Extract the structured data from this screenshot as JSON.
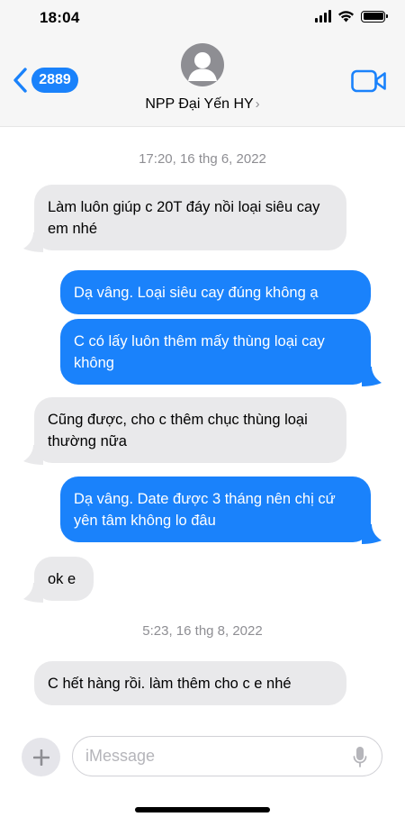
{
  "status_bar": {
    "time": "18:04",
    "icons": [
      "signal-icon",
      "wifi-icon",
      "battery-icon"
    ]
  },
  "header": {
    "back_badge": "2889",
    "contact_name": "NPP Đại Yến HY",
    "contact_chevron": "›",
    "icons": [
      "back-chevron-icon",
      "avatar-icon",
      "video-call-icon"
    ]
  },
  "colors": {
    "accent": "#1a82fb",
    "incoming_bubble": "#e9e9eb",
    "timestamp": "#8e8e93"
  },
  "conversation": {
    "timestamps": [
      "17:20, 16 thg 6, 2022",
      "5:23, 16 thg 8, 2022"
    ],
    "messages": [
      {
        "direction": "in",
        "text": "Làm luôn giúp c 20T đáy nồi loại siêu cay em nhé"
      },
      {
        "direction": "out",
        "text": "Dạ vâng. Loại siêu cay đúng không ạ"
      },
      {
        "direction": "out",
        "text": "C có lấy luôn thêm mấy thùng loại cay không"
      },
      {
        "direction": "in",
        "text": "Cũng được, cho c thêm chục thùng loại thường nữa"
      },
      {
        "direction": "out",
        "text": "Dạ vâng. Date được 3 tháng nên chị cứ yên tâm không lo đâu"
      },
      {
        "direction": "in",
        "text": "ok e"
      },
      {
        "direction": "in",
        "text": "C hết hàng rồi. làm thêm cho c e nhé"
      }
    ]
  },
  "input_bar": {
    "placeholder": "iMessage",
    "icons": [
      "plus-icon",
      "microphone-icon"
    ]
  }
}
